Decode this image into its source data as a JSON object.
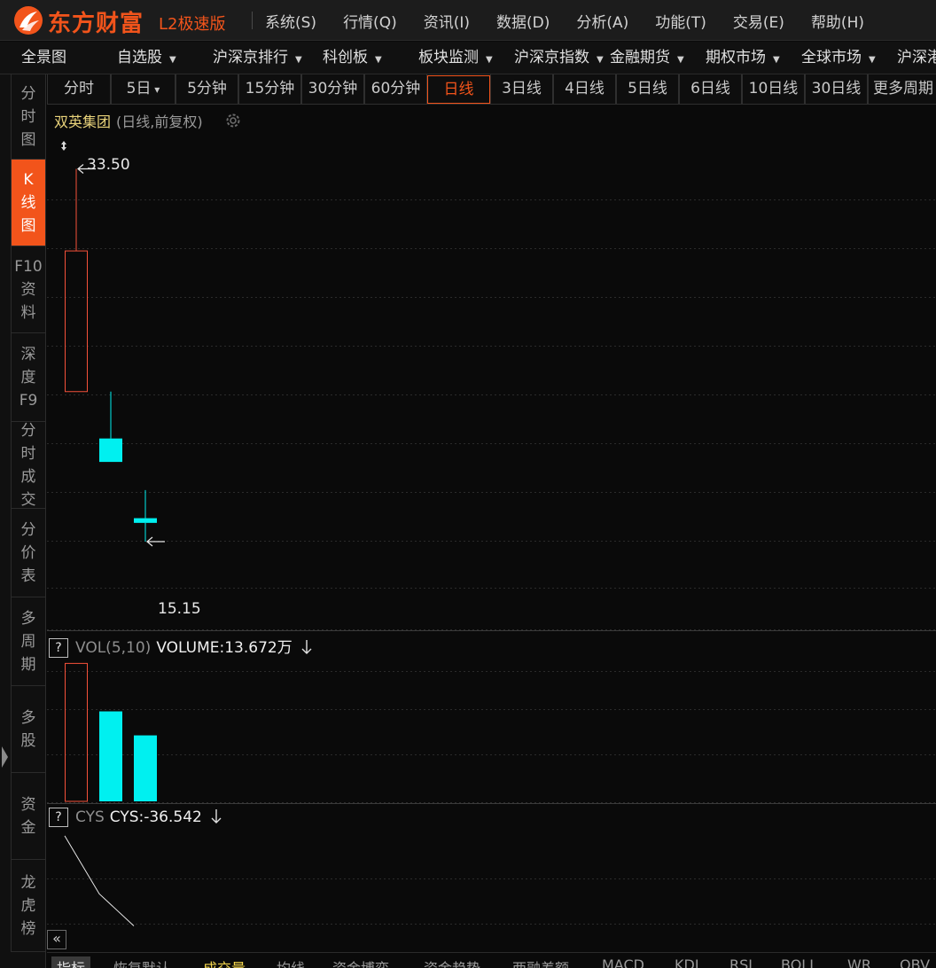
{
  "app": {
    "logo_text": "东方财富",
    "edition": "L2极速版"
  },
  "menu": [
    "系统(S)",
    "行情(Q)",
    "资讯(I)",
    "数据(D)",
    "分析(A)",
    "功能(T)",
    "交易(E)",
    "帮助(H)"
  ],
  "nav": [
    "全景图",
    "自选股",
    "沪深京排行",
    "科创板",
    "板块监测",
    "沪深京指数",
    "金融期货",
    "期权市场",
    "全球市场",
    "沪深港"
  ],
  "sidebar": [
    {
      "label": [
        "分",
        "时",
        "图"
      ],
      "active": false
    },
    {
      "label": [
        "K",
        "线",
        "图"
      ],
      "active": true
    },
    {
      "label": [
        "F10",
        "资",
        "料"
      ],
      "active": false
    },
    {
      "label": [
        "深",
        "度",
        "F9"
      ],
      "active": false
    },
    {
      "label": [
        "分",
        "时",
        "成",
        "交"
      ],
      "active": false
    },
    {
      "label": [
        "分",
        "价",
        "表"
      ],
      "active": false
    },
    {
      "label": [
        "多",
        "周",
        "期"
      ],
      "active": false
    },
    {
      "label": [
        "多",
        "股"
      ],
      "active": false
    },
    {
      "label": [
        "资",
        "金"
      ],
      "active": false
    },
    {
      "label": [
        "龙",
        "虎",
        "榜"
      ],
      "active": false
    }
  ],
  "periods": [
    "分时",
    "5日",
    "5分钟",
    "15分钟",
    "30分钟",
    "60分钟",
    "日线",
    "3日线",
    "4日线",
    "5日线",
    "6日线",
    "10日线",
    "30日线",
    "更多周期"
  ],
  "active_period": "日线",
  "stock": {
    "name": "双英集团",
    "meta": "(日线,前复权)"
  },
  "price_labels": {
    "high": "33.50",
    "low": "15.15"
  },
  "vol_panel": {
    "help": "?",
    "name": "VOL(5,10)",
    "value": "VOLUME:13.672万"
  },
  "cys_panel": {
    "help": "?",
    "name": "CYS",
    "value": "CYS:-36.542"
  },
  "bottom_tabs": [
    "指标",
    "恢复默认",
    "成交量",
    "均线",
    "资金博弈",
    "资金趋势",
    "两融差额",
    "MACD",
    "KDJ",
    "RSI",
    "BOLL",
    "WR",
    "OBV"
  ],
  "colors": {
    "up": "#f5513a",
    "down": "#00f0f0",
    "accent": "#f2541b",
    "stock_name": "#e8d27a"
  },
  "chart_data": {
    "type": "candlestick",
    "candles": [
      {
        "open": 24.0,
        "close": 30.0,
        "high": 33.5,
        "low": 24.0,
        "direction": "up"
      },
      {
        "open": 22.0,
        "close": 21.0,
        "high": 24.0,
        "low": 21.0,
        "direction": "down"
      },
      {
        "open": 18.6,
        "close": 18.4,
        "high": 19.8,
        "low": 17.6,
        "direction": "down"
      }
    ],
    "volume": [
      {
        "value": 23.0,
        "direction": "up"
      },
      {
        "value": 15.0,
        "direction": "down"
      },
      {
        "value": 11.0,
        "direction": "down"
      }
    ],
    "cys": [
      10,
      -20,
      -36.542
    ],
    "price_range": [
      14.5,
      34.2
    ],
    "volume_max": 23.5,
    "cys_range": [
      -40,
      15
    ]
  }
}
